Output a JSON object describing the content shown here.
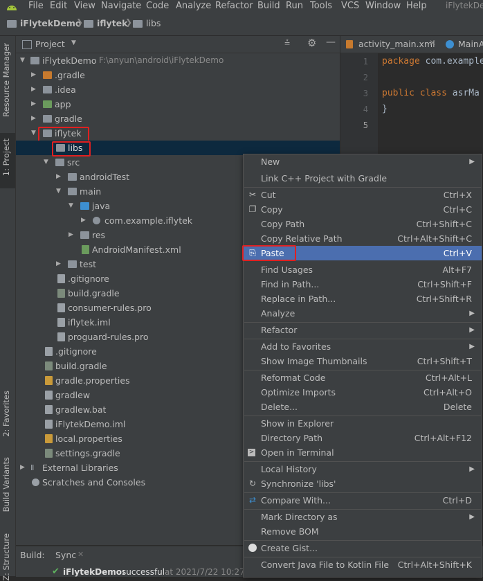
{
  "menubar": {
    "items": [
      "File",
      "Edit",
      "View",
      "Navigate",
      "Code",
      "Analyze",
      "Refactor",
      "Build",
      "Run",
      "Tools",
      "VCS",
      "Window",
      "Help"
    ],
    "window_title": "iFlytekDe"
  },
  "navbar": {
    "crumbs": [
      "iFlytekDemo",
      "iflytek",
      "libs"
    ]
  },
  "leftstripe": {
    "tabs": [
      "Resource Manager",
      "1: Project",
      "2: Favorites",
      "Build Variants",
      "Z: Structure"
    ]
  },
  "project_panel": {
    "title": "Project",
    "tree": [
      {
        "label": "iFlytekDemo",
        "path": "F:\\anyun\\android\\iFlytekDemo"
      },
      {
        "label": ".gradle"
      },
      {
        "label": ".idea"
      },
      {
        "label": "app"
      },
      {
        "label": "gradle"
      },
      {
        "label": "iflytek"
      },
      {
        "label": "libs"
      },
      {
        "label": "src"
      },
      {
        "label": "androidTest"
      },
      {
        "label": "main"
      },
      {
        "label": "java"
      },
      {
        "label": "com.example.iflytek"
      },
      {
        "label": "res"
      },
      {
        "label": "AndroidManifest.xml"
      },
      {
        "label": "test"
      },
      {
        "label": ".gitignore"
      },
      {
        "label": "build.gradle"
      },
      {
        "label": "consumer-rules.pro"
      },
      {
        "label": "iflytek.iml"
      },
      {
        "label": "proguard-rules.pro"
      },
      {
        "label": ".gitignore"
      },
      {
        "label": "build.gradle"
      },
      {
        "label": "gradle.properties"
      },
      {
        "label": "gradlew"
      },
      {
        "label": "gradlew.bat"
      },
      {
        "label": "iFlytekDemo.iml"
      },
      {
        "label": "local.properties"
      },
      {
        "label": "settings.gradle"
      },
      {
        "label": "External Libraries"
      },
      {
        "label": "Scratches and Consoles"
      }
    ]
  },
  "editor": {
    "tabs": [
      "activity_main.xml",
      "MainA"
    ],
    "line_numbers": [
      "1",
      "2",
      "3",
      "4",
      "5"
    ],
    "lines": [
      {
        "kw": "package",
        "rest": " com.example"
      },
      {
        "kw": "",
        "rest": ""
      },
      {
        "kw": "public class",
        "rest": " asrMa"
      },
      {
        "kw": "",
        "rest": "}"
      },
      {
        "kw": "",
        "rest": ""
      }
    ]
  },
  "bottom": {
    "build_label": "Build:",
    "sync_tab": "Sync",
    "status_name": "iFlytekDemo:",
    "status_text": "successful",
    "status_time": "at 2021/7/22 10:27"
  },
  "context_menu": {
    "items": [
      {
        "label": "New",
        "shortcut": "",
        "submenu": true
      },
      {
        "label": "Link C++ Project with Gradle",
        "shortcut": ""
      },
      {
        "label": "Cut",
        "shortcut": "Ctrl+X",
        "icon": "scissors-icon"
      },
      {
        "label": "Copy",
        "shortcut": "Ctrl+C",
        "icon": "copy-icon"
      },
      {
        "label": "Copy Path",
        "shortcut": "Ctrl+Shift+C"
      },
      {
        "label": "Copy Relative Path",
        "shortcut": "Ctrl+Alt+Shift+C"
      },
      {
        "label": "Paste",
        "shortcut": "Ctrl+V",
        "icon": "clipboard-icon",
        "active": true
      },
      {
        "label": "Find Usages",
        "shortcut": "Alt+F7"
      },
      {
        "label": "Find in Path...",
        "shortcut": "Ctrl+Shift+F"
      },
      {
        "label": "Replace in Path...",
        "shortcut": "Ctrl+Shift+R"
      },
      {
        "label": "Analyze",
        "shortcut": "",
        "submenu": true
      },
      {
        "label": "Refactor",
        "shortcut": "",
        "submenu": true
      },
      {
        "label": "Add to Favorites",
        "shortcut": "",
        "submenu": true
      },
      {
        "label": "Show Image Thumbnails",
        "shortcut": "Ctrl+Shift+T"
      },
      {
        "label": "Reformat Code",
        "shortcut": "Ctrl+Alt+L"
      },
      {
        "label": "Optimize Imports",
        "shortcut": "Ctrl+Alt+O"
      },
      {
        "label": "Delete...",
        "shortcut": "Delete"
      },
      {
        "label": "Show in Explorer",
        "shortcut": ""
      },
      {
        "label": "Directory Path",
        "shortcut": "Ctrl+Alt+F12"
      },
      {
        "label": "Open in Terminal",
        "shortcut": "",
        "icon": "terminal-icon"
      },
      {
        "label": "Local History",
        "shortcut": "",
        "submenu": true
      },
      {
        "label": "Synchronize 'libs'",
        "shortcut": "",
        "icon": "sync-icon"
      },
      {
        "label": "Compare With...",
        "shortcut": "Ctrl+D",
        "icon": "compare-icon"
      },
      {
        "label": "Mark Directory as",
        "shortcut": "",
        "submenu": true
      },
      {
        "label": "Remove BOM",
        "shortcut": ""
      },
      {
        "label": "Create Gist...",
        "shortcut": "",
        "icon": "github-icon"
      },
      {
        "label": "Convert Java File to Kotlin File",
        "shortcut": "Ctrl+Alt+Shift+K"
      }
    ]
  },
  "colors": {
    "selection": "#0d293e",
    "menu_active": "#4b6eaf",
    "highlight_box": "#e02020"
  }
}
